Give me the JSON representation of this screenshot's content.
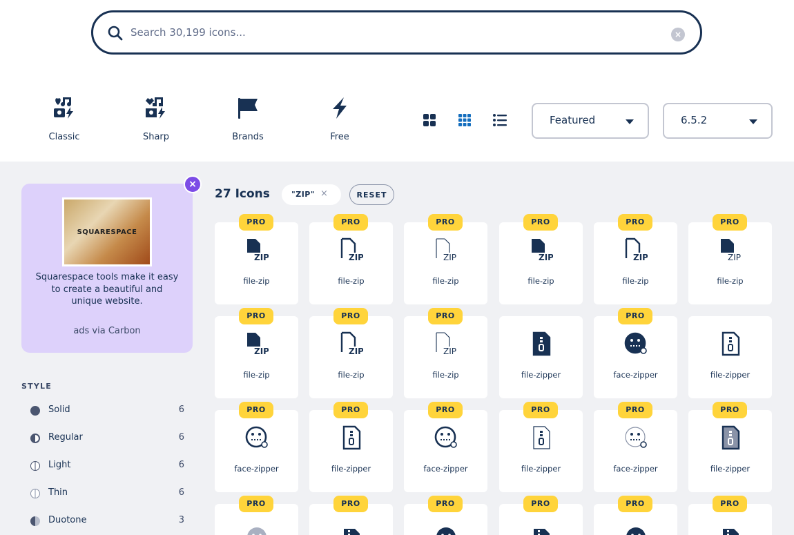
{
  "search": {
    "placeholder": "Search 30,199 icons..."
  },
  "families": [
    {
      "label": "Classic",
      "icon": "music-heart-bolt-icon"
    },
    {
      "label": "Sharp",
      "icon": "music-heart-bolt-sharp-icon"
    },
    {
      "label": "Brands",
      "icon": "flag-icon"
    },
    {
      "label": "Free",
      "icon": "bolt-icon"
    }
  ],
  "view_modes": [
    "large-grid",
    "grid",
    "list"
  ],
  "sort": {
    "value": "Featured"
  },
  "version": {
    "value": "6.5.2"
  },
  "ad": {
    "image_text": "SQUARESPACE",
    "copy": "Squarespace tools make it easy to create a beautiful and unique website.",
    "via": "ads via Carbon"
  },
  "styles": {
    "heading": "STYLE",
    "items": [
      {
        "name": "Solid",
        "count": "6"
      },
      {
        "name": "Regular",
        "count": "6"
      },
      {
        "name": "Light",
        "count": "6"
      },
      {
        "name": "Thin",
        "count": "6"
      },
      {
        "name": "Duotone",
        "count": "3"
      }
    ]
  },
  "results": {
    "count_label": "27 Icons",
    "query_chip": "\"ZIP\"",
    "reset_label": "RESET",
    "pro_label": "PRO"
  },
  "icons": [
    {
      "name": "file-zip",
      "pro": true
    },
    {
      "name": "file-zip",
      "pro": true
    },
    {
      "name": "file-zip",
      "pro": true
    },
    {
      "name": "file-zip",
      "pro": true
    },
    {
      "name": "file-zip",
      "pro": true
    },
    {
      "name": "file-zip",
      "pro": true
    },
    {
      "name": "file-zip",
      "pro": true
    },
    {
      "name": "file-zip",
      "pro": true
    },
    {
      "name": "file-zip",
      "pro": true
    },
    {
      "name": "file-zipper",
      "pro": false
    },
    {
      "name": "face-zipper",
      "pro": true
    },
    {
      "name": "file-zipper",
      "pro": false
    },
    {
      "name": "face-zipper",
      "pro": true
    },
    {
      "name": "file-zipper",
      "pro": true
    },
    {
      "name": "face-zipper",
      "pro": true
    },
    {
      "name": "file-zipper",
      "pro": true
    },
    {
      "name": "face-zipper",
      "pro": true
    },
    {
      "name": "file-zipper",
      "pro": true
    },
    {
      "name": "",
      "pro": true
    },
    {
      "name": "",
      "pro": true
    },
    {
      "name": "",
      "pro": true
    },
    {
      "name": "",
      "pro": true
    },
    {
      "name": "",
      "pro": true
    },
    {
      "name": "",
      "pro": true
    }
  ]
}
